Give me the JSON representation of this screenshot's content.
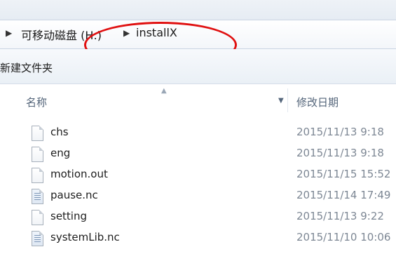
{
  "address_bar": {
    "crumbs": [
      {
        "label": "可移动磁盘 (H:)"
      },
      {
        "label": "installX"
      }
    ]
  },
  "toolbar": {
    "new_folder_label": "新建文件夹"
  },
  "columns": {
    "name_label": "名称",
    "date_label": "修改日期"
  },
  "files": [
    {
      "name": "chs",
      "modified": "2015/11/13 9:18",
      "icon": "blank-file-icon"
    },
    {
      "name": "eng",
      "modified": "2015/11/13 9:18",
      "icon": "blank-file-icon"
    },
    {
      "name": "motion.out",
      "modified": "2015/11/15 15:52",
      "icon": "blank-file-icon"
    },
    {
      "name": "pause.nc",
      "modified": "2015/11/14 17:49",
      "icon": "text-file-icon"
    },
    {
      "name": "setting",
      "modified": "2015/11/13 9:22",
      "icon": "blank-file-icon"
    },
    {
      "name": "systemLib.nc",
      "modified": "2015/11/10 10:06",
      "icon": "text-file-icon"
    }
  ],
  "annotation": {
    "color": "#e01010"
  }
}
